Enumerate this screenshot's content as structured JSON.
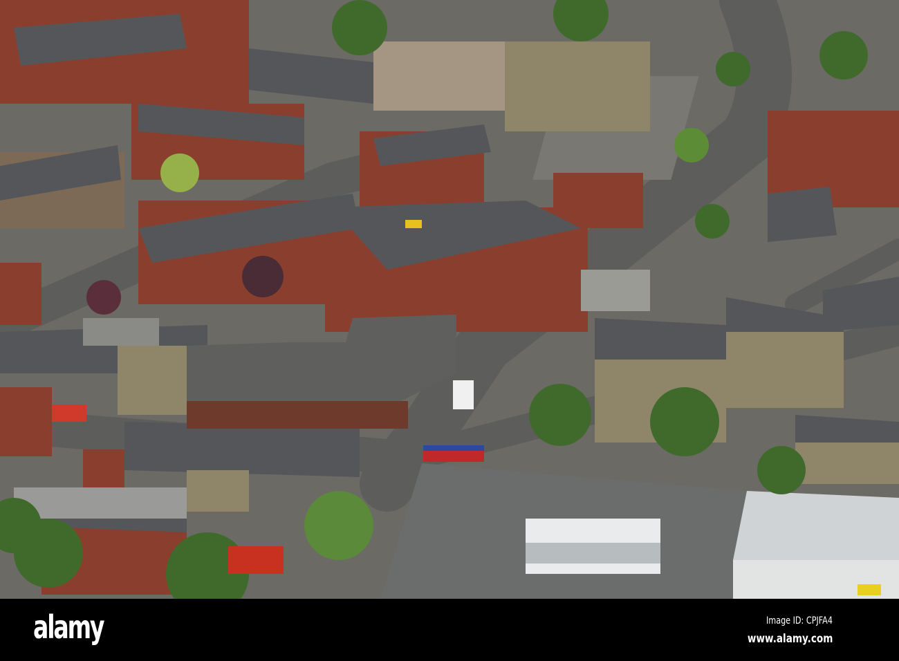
{
  "watermark": {
    "logo": "alamy",
    "image_id": "Image ID: CPJFA4",
    "url": "www.alamy.com"
  }
}
